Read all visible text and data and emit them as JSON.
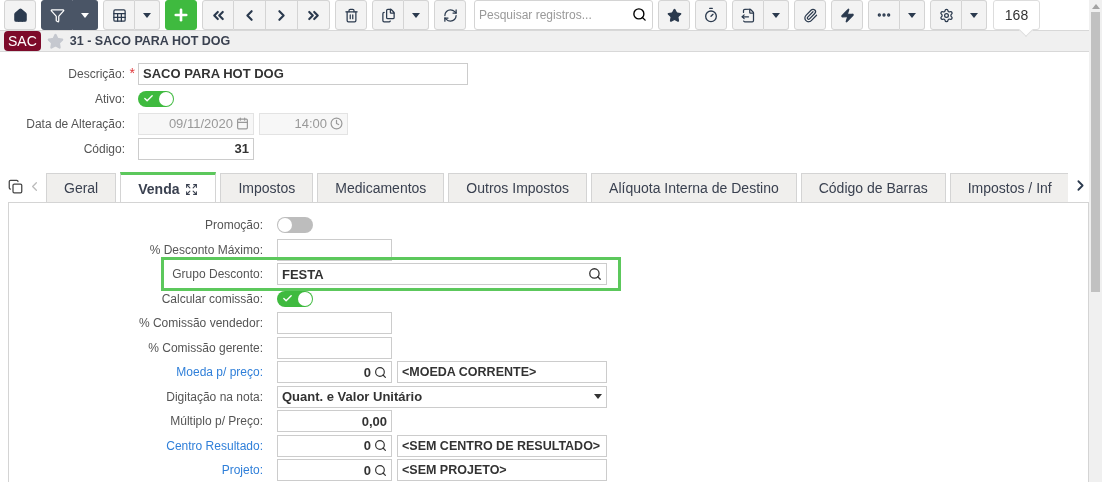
{
  "toolbar": {
    "filter_active": true,
    "search": {
      "placeholder": "Pesquisar registros..."
    },
    "record_count": "168"
  },
  "header": {
    "badge": "SAC",
    "favorite": false,
    "title": "31 - SACO PARA HOT DOG"
  },
  "form": {
    "description": {
      "label": "Descrição:",
      "required_mark": "*",
      "value": "SACO PARA HOT DOG"
    },
    "active": {
      "label": "Ativo:",
      "on": true
    },
    "changed": {
      "label": "Data de Alteração:",
      "date": "09/11/2020",
      "time": "14:00",
      "disabled": true
    },
    "code": {
      "label": "Código:",
      "value": "31"
    }
  },
  "tabs": [
    {
      "label": "Geral",
      "selected": false
    },
    {
      "label": "Venda",
      "selected": true
    },
    {
      "label": "Impostos",
      "selected": false
    },
    {
      "label": "Medicamentos",
      "selected": false
    },
    {
      "label": "Outros Impostos",
      "selected": false
    },
    {
      "label": "Alíquota Interna de Destino",
      "selected": false
    },
    {
      "label": "Código de Barras",
      "selected": false
    },
    {
      "label": "Impostos / Inf",
      "selected": false
    }
  ],
  "venda_fields": [
    {
      "kind": "toggle",
      "label": "Promoção:",
      "on": false
    },
    {
      "kind": "text",
      "label": "% Desconto Máximo:"
    },
    {
      "kind": "lookup",
      "label": "Grupo Desconto:",
      "value": "FESTA",
      "highlighted": true
    },
    {
      "kind": "toggle",
      "label": "Calcular comissão:",
      "on": true
    },
    {
      "kind": "text",
      "label": "% Comissão vendedor:"
    },
    {
      "kind": "text",
      "label": "% Comissão gerente:"
    },
    {
      "kind": "code_lookup",
      "label": "Moeda p/ preço:",
      "link": true,
      "value": "0",
      "description": "<MOEDA CORRENTE>"
    },
    {
      "kind": "select",
      "label": "Digitação na nota:",
      "value": "Quant. e Valor Unitário"
    },
    {
      "kind": "text",
      "label": "Múltiplo p/ Preço:",
      "value": "0,00"
    },
    {
      "kind": "code_lookup",
      "label": "Centro Resultado:",
      "link": true,
      "value": "0",
      "description": "<SEM CENTRO DE RESULTADO>"
    },
    {
      "kind": "code_lookup",
      "label": "Projeto:",
      "link": true,
      "value": "0",
      "description": "<SEM PROJETO>"
    }
  ]
}
